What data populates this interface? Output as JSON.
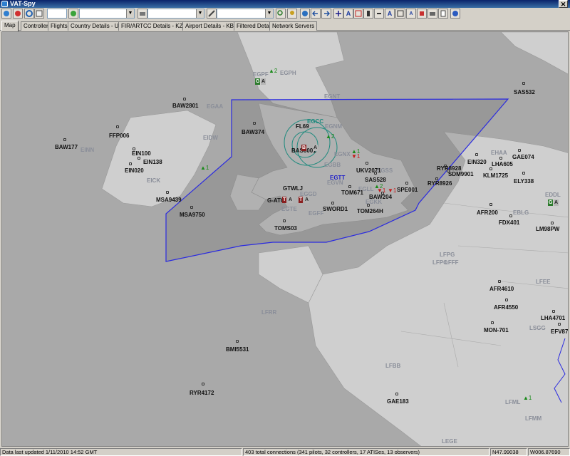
{
  "window": {
    "title": "VAT-Spy",
    "close_glyph": "✕"
  },
  "toolbar": {
    "combo1_value": "",
    "combo2_value": "",
    "combo3_value": "",
    "letter_a1": "A",
    "letter_a2": "A",
    "letter_a3": "A"
  },
  "tabs": [
    "Map",
    "Controllers",
    "Flights",
    "Country Details - USA",
    "FIR/ARTCC Details - KZBW",
    "Airport Details - KBOS",
    "Filtered Details",
    "Network Servers"
  ],
  "map": {
    "colors": {
      "sea": "#a9a9a9",
      "land": "#cfcfcf",
      "sector": "#2a2ae0",
      "badge_green": "#2c7a2c",
      "badge_red": "#8a1f1f"
    },
    "fir_label": "EGTT",
    "controller_label": "EGCC",
    "flights": [
      "BAW2801",
      "BAW374",
      "FFP006",
      "BAW177",
      "EIN100",
      "EIN138",
      "EIN020",
      "MSA9439",
      "MSA9750",
      "GTWLJ",
      "G-ATG",
      "TOMS03",
      "TOM671",
      "SWORD1",
      "TOM264H",
      "UKV2071",
      "SAS528",
      "BAW204",
      "SPE001",
      "RYR8928",
      "SDM9901",
      "RYR8926",
      "EIN320",
      "KLM1725",
      "LHA605",
      "GAE074",
      "ELY338",
      "SAS532",
      "AFR200",
      "FDX401",
      "LM98PW",
      "AFR4610",
      "AFR4550",
      "MON-701",
      "LHA4701",
      "EFV87",
      "BMI5531",
      "RYR4172",
      "GAE183",
      "BAS6001",
      "FL69"
    ],
    "airports": [
      "EGPF",
      "EGPH",
      "EGNT",
      "EGAA",
      "EIDW",
      "EINN",
      "EICK",
      "EGNM",
      "EGNX",
      "EGBB",
      "EGSS",
      "EGLL",
      "EGKK",
      "EGVN",
      "EGFF",
      "EGGD",
      "EGTE",
      "EHAA",
      "EDDL",
      "EBLG",
      "LFPG",
      "LFPO",
      "LFFF",
      "LFEE",
      "LFRR",
      "LFBB",
      "LSGG",
      "LFML",
      "LFMM",
      "LEGE"
    ],
    "counts": [
      "2",
      "2",
      "1",
      "1",
      "1",
      "2",
      "1",
      "1",
      "1"
    ],
    "badges": [
      "G",
      "A",
      "G",
      "A",
      "T",
      "A",
      "T",
      "A",
      "B",
      "A"
    ]
  },
  "status": {
    "updated": "Data last updated 1/11/2010 14:52 GMT",
    "connections": "403 total connections (341 pilots, 32 controllers, 17 ATISes, 13 observers)",
    "lat": "N47.99038",
    "lon": "W006.87690"
  }
}
